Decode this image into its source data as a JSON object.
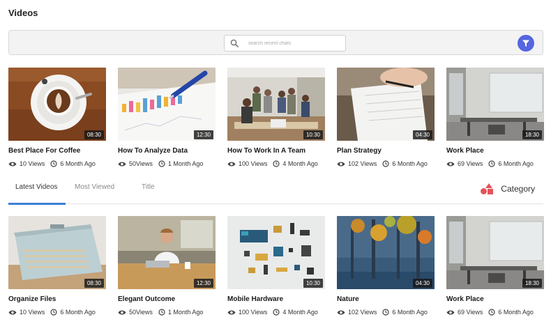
{
  "page": {
    "title": "Videos"
  },
  "search": {
    "placeholder": "search recent chats"
  },
  "tabs": {
    "items": [
      "Latest Videos",
      "Most Viewed",
      "Title"
    ],
    "category_label": "Category"
  },
  "colors": {
    "accent": "#3b7fd8",
    "filter_button": "#5566e0",
    "category_icon": "#e2545a"
  },
  "videos_top": [
    {
      "title": "Best Place For Coffee",
      "duration": "08:30",
      "views": "10 Views",
      "age": "6 Month Ago"
    },
    {
      "title": "How To Analyze Data",
      "duration": "12:30",
      "views": "50Views",
      "age": "1 Month Ago"
    },
    {
      "title": "How To Work In A Team",
      "duration": "10:30",
      "views": "100 Views",
      "age": "4 Month Ago"
    },
    {
      "title": "Plan  Strategy",
      "duration": "04:30",
      "views": "102 Views",
      "age": "6 Month Ago"
    },
    {
      "title": "Work Place",
      "duration": "18:30",
      "views": "69 Views",
      "age": "6 Month Ago"
    }
  ],
  "videos_bottom": [
    {
      "title": "Organize Files",
      "duration": "08:30",
      "views": "10 Views",
      "age": "6 Month Ago"
    },
    {
      "title": "Elegant Outcome",
      "duration": "12:30",
      "views": "50Views",
      "age": "1 Month Ago"
    },
    {
      "title": "Mobile Hardware",
      "duration": "10:30",
      "views": "100 Views",
      "age": "4 Month Ago"
    },
    {
      "title": "Nature",
      "duration": "04:30",
      "views": "102 Views",
      "age": "6 Month Ago"
    },
    {
      "title": "Work Place",
      "duration": "18:30",
      "views": "69 Views",
      "age": "6 Month Ago"
    }
  ]
}
